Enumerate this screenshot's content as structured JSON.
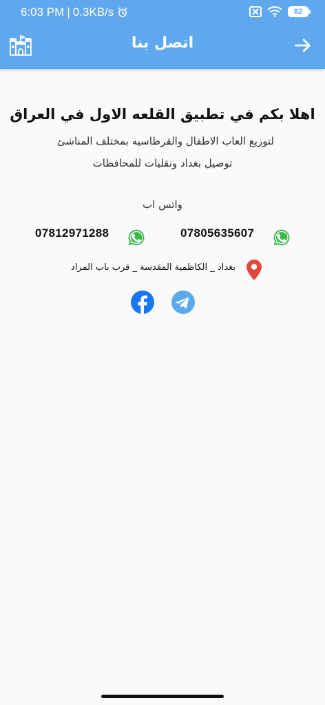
{
  "status_bar": {
    "time": "6:03 PM",
    "separator": "|",
    "speed": "0.3KB/s",
    "battery": "82"
  },
  "app_bar": {
    "title": "اتصل بنا"
  },
  "content": {
    "headline": "اهلا بكم في تطبيق القلعه الاول في العراق",
    "subtitle_1": "لتوزيع العاب الاطفال والقرطاسيه بمختلف المناشئ",
    "subtitle_2": "توصيل بغداد ونقليات للمحافظات",
    "whatsapp_label": "واتس اب",
    "phones": [
      "07805635607",
      "07812971288"
    ],
    "address": "بغداد _ الكاظمية المقدسة _ قرب باب المراد"
  },
  "icons": {
    "castle": "castle-icon",
    "back": "arrow-right-icon",
    "whatsapp": "whatsapp-icon",
    "location": "location-pin-icon",
    "facebook": "facebook-icon",
    "telegram": "telegram-icon"
  },
  "colors": {
    "app_bar": "#5fa8ee",
    "whatsapp": "#3dba4e",
    "pin": "#e2483d",
    "facebook": "#1877f2",
    "telegram": "#5aa9ea"
  }
}
